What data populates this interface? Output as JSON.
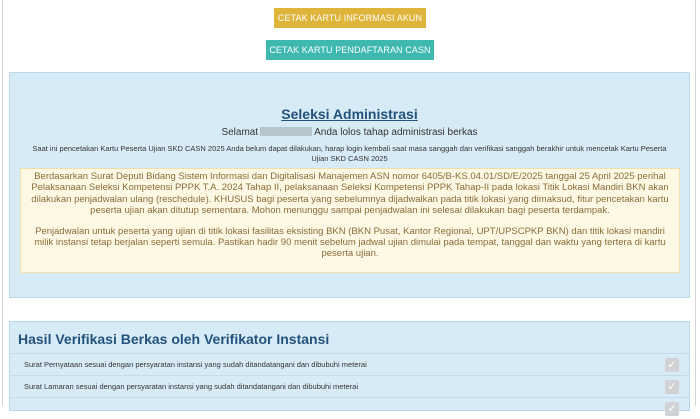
{
  "buttons": {
    "cetak_info": "CETAK KARTU INFORMASI AKUN",
    "cetak_casn": "CETAK KARTU PENDAFTARAN CASN"
  },
  "admin": {
    "title": "Seleksi Administrasi",
    "greeting_prefix": "Selamat",
    "greeting_suffix": "Anda lolos tahap administrasi berkas",
    "note": "Saat ini pencetakan Kartu Peserta Ujian SKD CASN 2025 Anda belum dapat dilakukan, harap login kembali saat masa sanggah dan verifikasi sanggah berakhir untuk mencetak Kartu Peserta Ujian SKD CASN 2025",
    "notice_p1": "Berdasarkan Surat Deputi Bidang Sistem Informasi dan Digitalisasi Manajemen ASN nomor 6405/B-KS.04.01/SD/E/2025 tanggal 25 April 2025 perihal Pelaksanaan Seleksi Kompetensi PPPK T.A. 2024 Tahap II, pelaksanaan Seleksi Kompetensi PPPK Tahap-II pada lokasi Titik Lokasi Mandiri BKN akan dilakukan penjadwalan ulang (reschedule). KHUSUS bagi peserta yang sebelumnya dijadwalkan pada titik lokasi yang dimaksud, fitur pencetakan kartu peserta ujian akan ditutup sementara. Mohon menunggu sampai penjadwalan ini selesai dilakukan bagi peserta terdampak.",
    "notice_p2": "Penjadwalan untuk peserta yang ujian di titik lokasi fasilitas eksisting BKN (BKN Pusat, Kantor Regional, UPT/UPSCPKP BKN) dan titik lokasi mandiri milik instansi tetap berjalan seperti semula. Pastikan hadir 90 menit sebelum jadwal ujian dimulai pada tempat, tanggal dan waktu yang tertera di kartu peserta ujian."
  },
  "verification": {
    "title": "Hasil Verifikasi Berkas oleh Verifikator Instansi",
    "items": [
      {
        "label": "Surat Pernyataan sesuai dengan persyaratan instansi yang sudah ditandatangani dan dibubuhi meterai",
        "check_icon": "check-icon"
      },
      {
        "label": "Surat Lamaran sesuai dengan persyaratan instansi yang sudah ditandatangani dan dibubuhi meterai",
        "check_icon": "check-icon"
      },
      {
        "label": "",
        "check_icon": "check-icon"
      }
    ]
  },
  "colors": {
    "button_info": "#dfb43a",
    "button_casn": "#3fb8af",
    "panel_bg": "#d7ebf6",
    "title_blue": "#23527c",
    "notice_bg": "#fcf8e3",
    "notice_text": "#8a6d3b"
  }
}
